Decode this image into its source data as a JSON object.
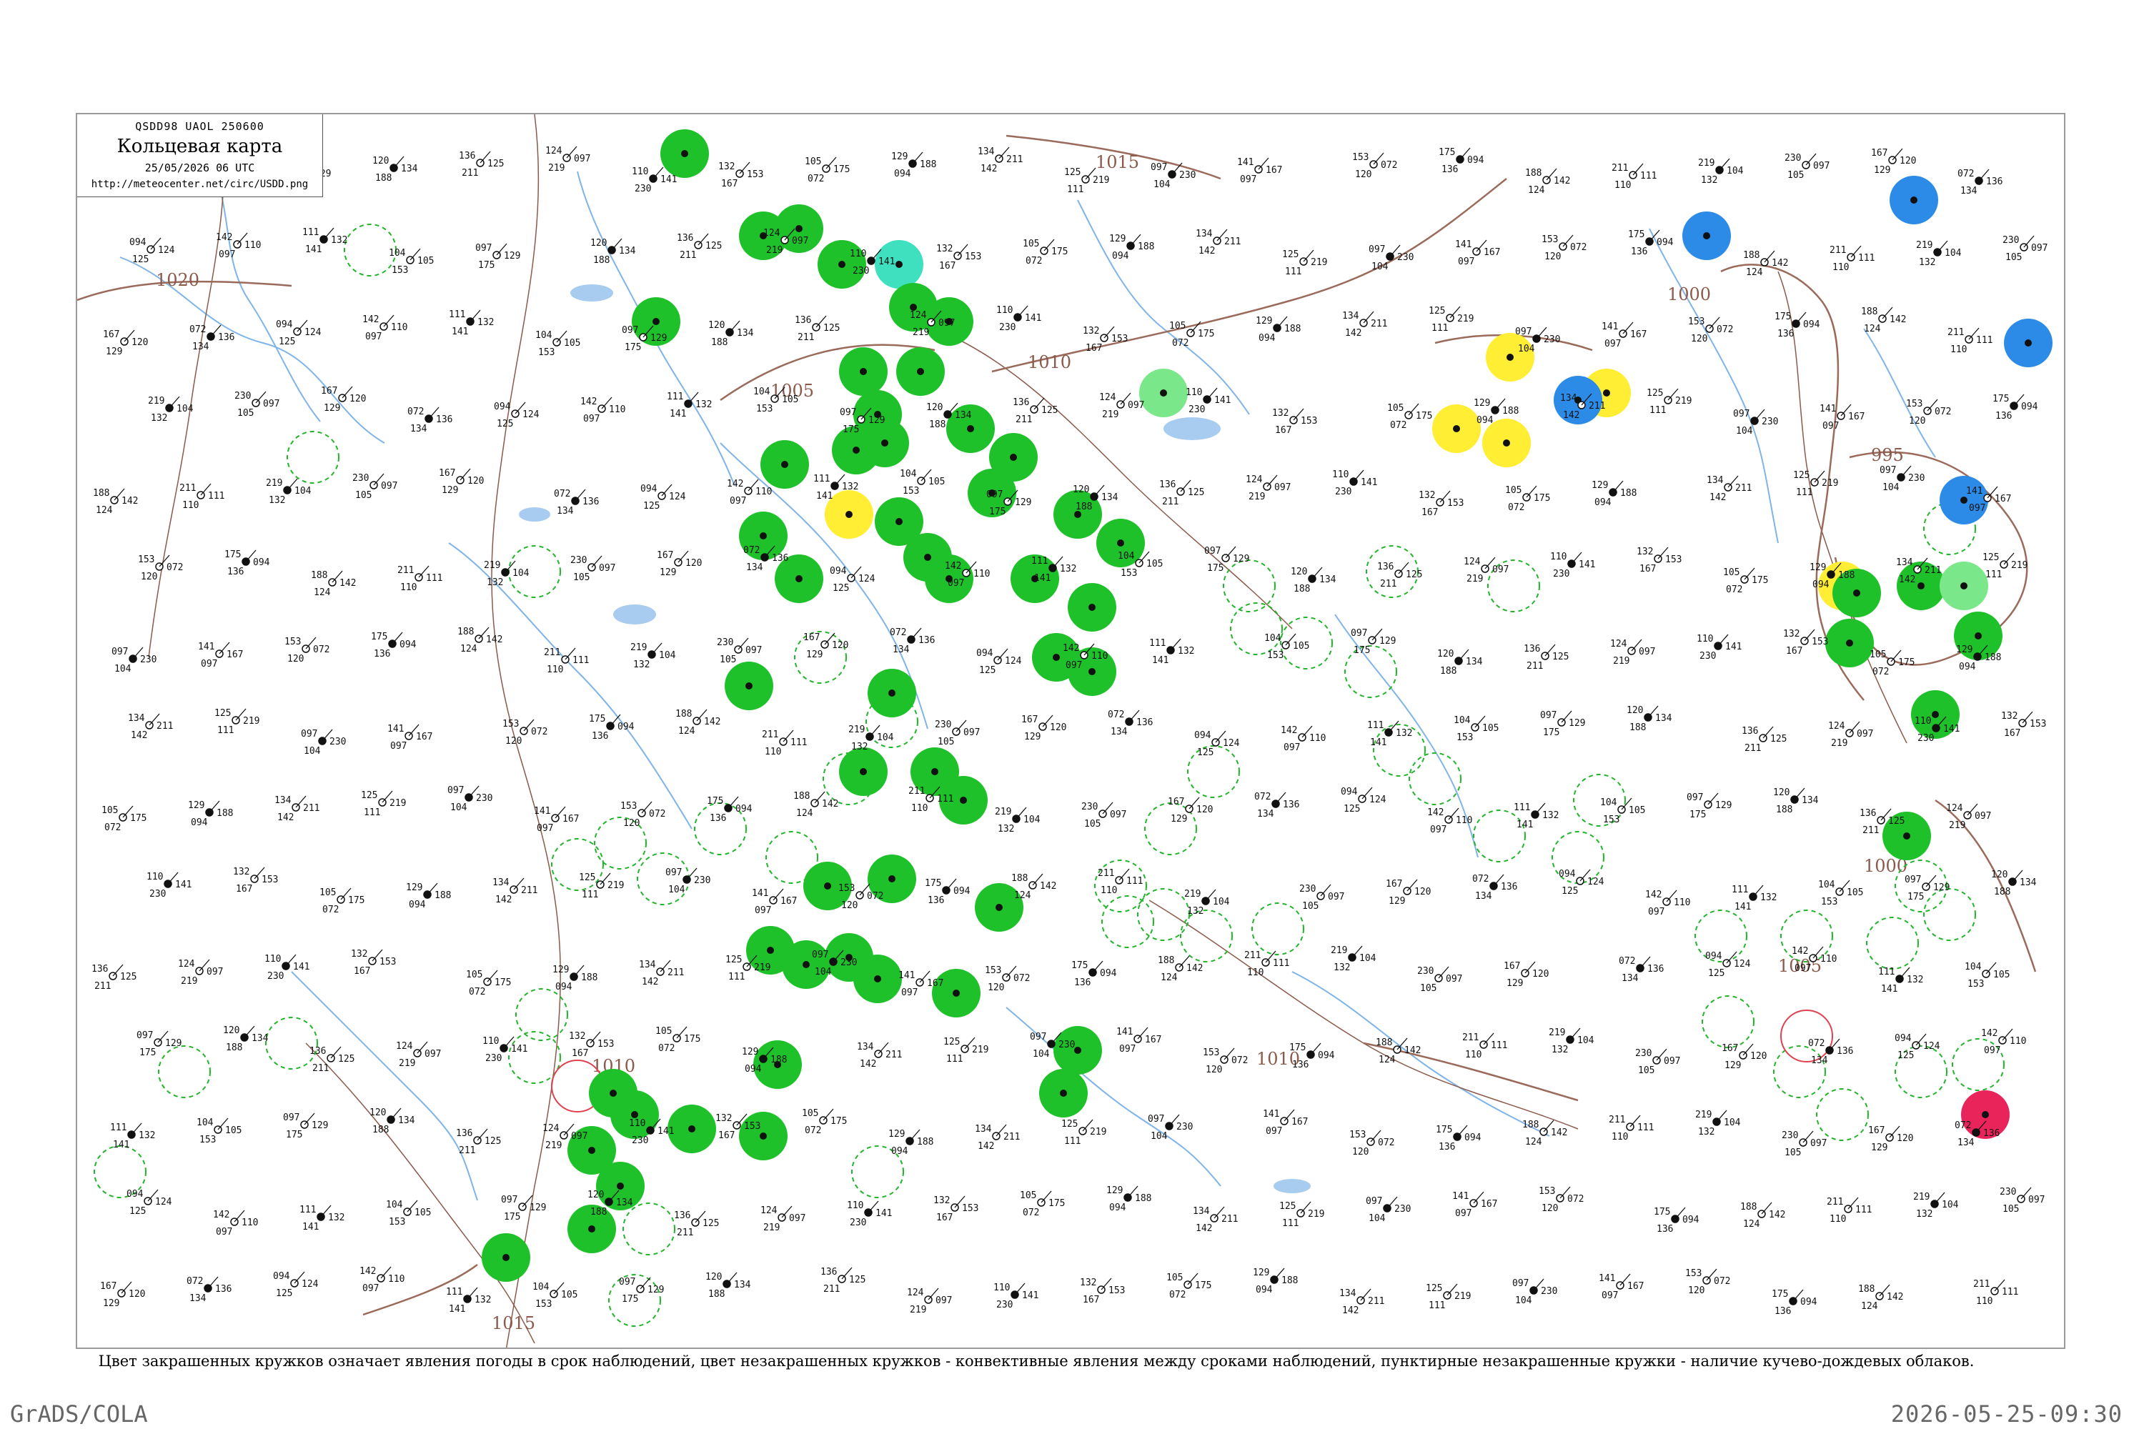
{
  "header": {
    "codes": "QSDD98  UAOL  250600",
    "title": "Кольцевая карта",
    "datetime": "25/05/2026 06 UTC",
    "url": "http://meteocenter.net/circ/USDD.png"
  },
  "legend_note": "Цвет закрашенных кружков означает явления погоды в срок наблюдений, цвет незакрашенных кружков - конвективные явления между сроками наблюдений, пунктирные незакрашенные кружки - наличие кучево-дождевых облаков.",
  "footer": {
    "left": "GrADS/COLA",
    "right": "2026-05-25-09:30"
  },
  "colors": {
    "rain": "#1ec12a",
    "fog_mist": "#ffee33",
    "snow": "#2b8be6",
    "thunder": "#e8245a",
    "drizzle": "#3ee0c0",
    "light_rain": "#7ae88a",
    "isobar": "#9a6a5a",
    "river": "#7fb4e8",
    "conv_ring": "#22b42a"
  },
  "isobars": [
    {
      "label": "1015"
    },
    {
      "label": "1010"
    },
    {
      "label": "1005"
    },
    {
      "label": "1000"
    },
    {
      "label": "995"
    },
    {
      "label": "1020"
    }
  ],
  "station_numbers": [
    "111",
    "104",
    "097",
    "120",
    "136",
    "124",
    "110",
    "132",
    "105",
    "129",
    "134",
    "125",
    "097",
    "141",
    "153",
    "175",
    "188",
    "211",
    "219",
    "230",
    "167",
    "072",
    "094",
    "142"
  ]
}
